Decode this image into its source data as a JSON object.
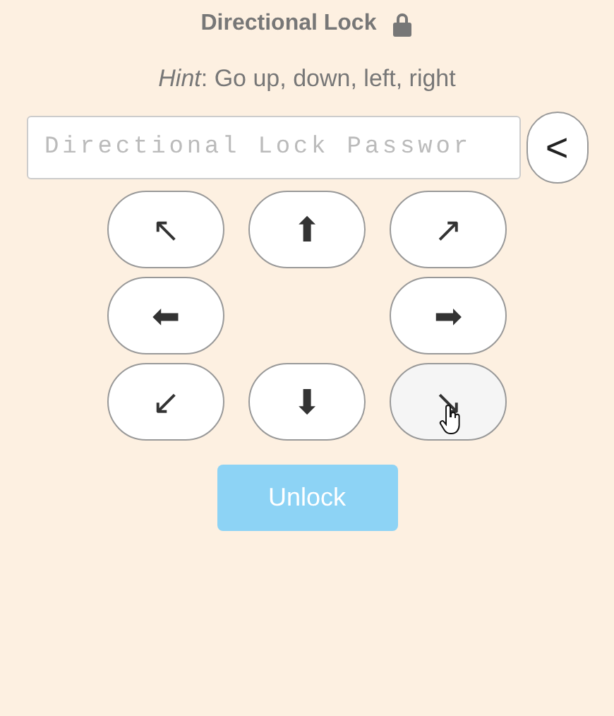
{
  "title": "Directional Lock",
  "hint": "*Hint*: Go up, down, left, right",
  "password_field": {
    "placeholder": "Directional Lock Passwor"
  },
  "backspace": {
    "label": "<"
  },
  "keypad": [
    [
      {
        "kind": "key",
        "symbol": "↖",
        "hovered": false
      },
      {
        "kind": "key",
        "symbol": "⬆",
        "hovered": false
      },
      {
        "kind": "key",
        "symbol": "↗",
        "hovered": false
      }
    ],
    [
      {
        "kind": "key",
        "symbol": "⬅",
        "hovered": false
      },
      {
        "kind": "gap"
      },
      {
        "kind": "key",
        "symbol": "➡",
        "hovered": false
      }
    ],
    [
      {
        "kind": "key",
        "symbol": "↙",
        "hovered": false
      },
      {
        "kind": "key",
        "symbol": "⬇",
        "hovered": false
      },
      {
        "kind": "key",
        "symbol": "↘",
        "hovered": true
      }
    ]
  ],
  "unlock_button": {
    "label": "Unlock",
    "disabled": true
  }
}
